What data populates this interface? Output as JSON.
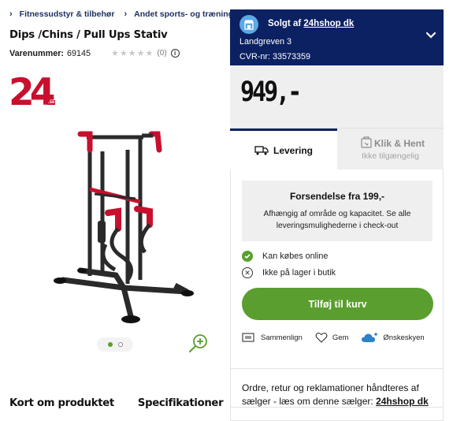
{
  "breadcrumb": {
    "items": [
      "Fitnessudstyr & tilbehør",
      "Andet sports- og træningsudstyr"
    ]
  },
  "product": {
    "title": "Dips /Chins / Pull Ups Stativ",
    "sku_label": "Varenummer:",
    "sku_value": "69145",
    "rating_stars": 0,
    "rating_max": 5,
    "review_count": "(0)"
  },
  "logo": {
    "number": "24",
    "suffix": ".se"
  },
  "gallery": {
    "images": 2,
    "active_index": 0
  },
  "section_tabs": [
    "Kort om produktet",
    "Specifikationer"
  ],
  "seller": {
    "sold_by_prefix": "Solgt af ",
    "name": "24hshop dk",
    "address": "Landgreven 3",
    "cvr": "CVR-nr: 33573359"
  },
  "price": "949,-",
  "delivery_tabs": {
    "delivery_label": "Levering",
    "pickup_label": "Klik & Hent",
    "pickup_sub": "Ikke tilgængelig"
  },
  "shipping": {
    "title": "Forsendelse fra 199,-",
    "text": "Afhængig af område og kapacitet. Se alle leveringsmulighederne i check-out"
  },
  "availability": {
    "online": "Kan købes online",
    "store": "Ikke på lager i butik"
  },
  "cta": {
    "add_to_cart": "Tilføj til kurv"
  },
  "actions": {
    "compare": "Sammenlign",
    "save": "Gem",
    "wishlist": "Ønskeskyen"
  },
  "footer": {
    "text": "Ordre, retur og reklamationer håndteres af sælger - læs om denne sælger: ",
    "seller_link": "24hshop dk"
  },
  "colors": {
    "navy": "#0c2162",
    "green": "#5a9e2f",
    "brand_red": "#c8102e",
    "light_gray": "#efefef"
  },
  "icons": [
    "chevron-right-icon",
    "star-icon",
    "info-icon",
    "shop-icon",
    "chevron-down-icon",
    "truck-icon",
    "store-pickup-icon",
    "check-icon",
    "x-circle-icon",
    "compare-icon",
    "heart-icon",
    "cloud-plus-icon",
    "zoom-in-icon"
  ]
}
